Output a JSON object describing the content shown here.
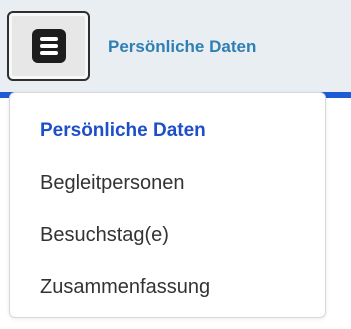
{
  "header": {
    "current_step": "Persönliche Daten",
    "menu_icon": "hamburger-icon"
  },
  "menu": {
    "items": [
      {
        "label": "Persönliche Daten",
        "active": true
      },
      {
        "label": "Begleitpersonen",
        "active": false
      },
      {
        "label": "Besuchstag(e)",
        "active": false
      },
      {
        "label": "Zusammenfassung",
        "active": false
      }
    ]
  },
  "colors": {
    "accent": "#1e5bd7",
    "active_item": "#1f4fc8",
    "header_text": "#2f7fb4"
  }
}
